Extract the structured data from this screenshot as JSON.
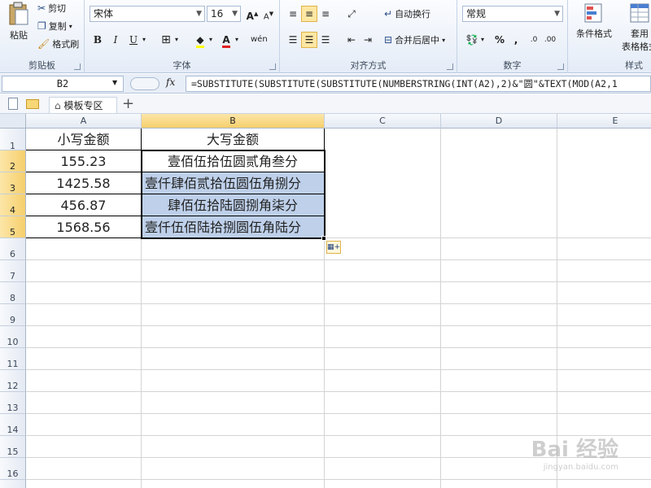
{
  "ribbon": {
    "clipboard": {
      "paste": "粘贴",
      "cut": "剪切",
      "copy": "复制",
      "format_painter": "格式刷",
      "label": "剪贴板"
    },
    "font": {
      "name": "宋体",
      "size": "16",
      "bold": "B",
      "italic": "I",
      "underline": "U",
      "label": "字体"
    },
    "alignment": {
      "wrap_text": "自动换行",
      "merge_center": "合并后居中",
      "label": "对齐方式"
    },
    "number": {
      "format": "常规",
      "percent": "%",
      "comma": ",",
      "label": "数字"
    },
    "styles": {
      "conditional": "条件格式",
      "table_format_1": "套用",
      "table_format_2": "表格格式",
      "label": "样式"
    }
  },
  "formula_bar": {
    "name_box": "B2",
    "fx": "fx",
    "formula": "=SUBSTITUTE(SUBSTITUTE(SUBSTITUTE(NUMBERSTRING(INT(A2),2)&\"圆\"&TEXT(MOD(A2,1"
  },
  "tabs": {
    "template_zone": "模板专区",
    "add": "+"
  },
  "sheet": {
    "columns": [
      "A",
      "B",
      "C",
      "D",
      "E"
    ],
    "rows": [
      "1",
      "2",
      "3",
      "4",
      "5",
      "6",
      "7",
      "8",
      "9",
      "10",
      "11",
      "12",
      "13",
      "14",
      "15",
      "16"
    ],
    "header_a": "小写金额",
    "header_b": "大写金额",
    "data": [
      {
        "amount": "155.23",
        "chinese": "壹佰伍拾伍圆贰角叁分"
      },
      {
        "amount": "1425.58",
        "chinese": "壹仟肆佰贰拾伍圆伍角捌分"
      },
      {
        "amount": "456.87",
        "chinese": "肆佰伍拾陆圆捌角柒分"
      },
      {
        "amount": "1568.56",
        "chinese": "壹仟伍佰陆拾捌圆伍角陆分"
      }
    ]
  },
  "watermark": {
    "brand": "Bai 经验",
    "url": "jingyan.baidu.com"
  }
}
